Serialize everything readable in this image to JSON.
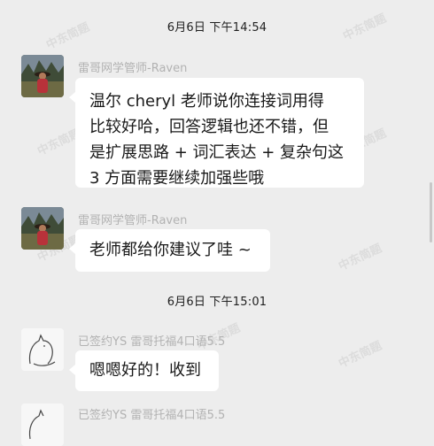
{
  "chat": {
    "timestamps": [
      "6月6日 下午14:54",
      "6月6日 下午15:01"
    ],
    "messages": [
      {
        "sender": "雷哥网学管师-Raven",
        "lines": [
          "温尔 cheryl 老师说你连接词用得",
          "比较好哈，回答逻辑也还不错，但",
          "是扩展思路 + 词汇表达 + 复杂句这",
          "3 方面需要继续加强些哦"
        ]
      },
      {
        "sender": "雷哥网学管师-Raven",
        "lines": [
          "老师都给你建议了哇 ~"
        ]
      },
      {
        "sender": "已签约YS 雷哥托福4口语5.5",
        "lines": [
          "嗯嗯好的！收到"
        ]
      },
      {
        "sender": "已签约YS 雷哥托福4口语5.5",
        "lines": []
      }
    ]
  },
  "watermark": "中东简题",
  "colors": {
    "background": "#ededed",
    "bubble": "#ffffff",
    "sender": "#b2b2b2"
  }
}
